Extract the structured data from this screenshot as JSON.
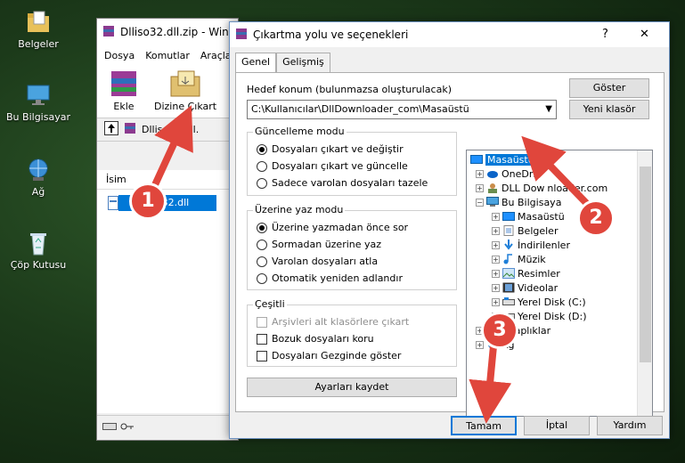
{
  "desktop": {
    "icons": [
      {
        "label": "Belgeler"
      },
      {
        "label": "Bu Bilgisayar"
      },
      {
        "label": "Ağ"
      },
      {
        "label": "Çöp Kutusu"
      }
    ]
  },
  "winrar": {
    "title": "Dlliso32.dll.zip - Win",
    "menu": [
      "Dosya",
      "Komutlar",
      "Araçla"
    ],
    "tools": {
      "add": "Ekle",
      "extract": "Dizine Çıkart"
    },
    "address": "Dlliso32.dll.",
    "column": "İsim",
    "file": "dlliso32.dll"
  },
  "dialog": {
    "title": "Çıkartma yolu ve seçenekleri",
    "help_btn": "?",
    "close_btn": "✕",
    "tabs": [
      "Genel",
      "Gelişmiş"
    ],
    "dest_label": "Hedef konum (bulunmazsa oluşturulacak)",
    "dest_value": "C:\\Kullanıcılar\\DllDownloader_com\\Masaüstü",
    "show_btn": "Göster",
    "new_folder_btn": "Yeni klasör",
    "update_group": {
      "title": "Güncelleme modu",
      "options": [
        "Dosyaları çıkart ve değiştir",
        "Dosyaları çıkart ve güncelle",
        "Sadece varolan dosyaları tazele"
      ]
    },
    "overwrite_group": {
      "title": "Üzerine yaz modu",
      "options": [
        "Üzerine yazmadan önce sor",
        "Sormadan üzerine yaz",
        "Varolan dosyaları atla",
        "Otomatik yeniden adlandır"
      ]
    },
    "misc_group": {
      "title": "Çeşitli",
      "options": [
        "Arşivleri alt klasörlere çıkart",
        "Bozuk dosyaları koru",
        "Dosyaları Gezginde göster"
      ]
    },
    "save_btn": "Ayarları kaydet",
    "tree": {
      "root": "Masaüstü",
      "items": [
        "OneDri",
        "DLL Dow",
        "Bu Bilgisaya",
        "Masaüstü",
        "Belgeler",
        "İndirilenler",
        "Müzik",
        "Resimler",
        "Videolar",
        "Yerel Disk (C:)",
        "Yerel Disk (D:)",
        "Kitaplıklar",
        "Ağ"
      ],
      "overlay_text": "nloader.com"
    },
    "ok_btn": "Tamam",
    "cancel_btn": "İptal",
    "help_footer_btn": "Yardım"
  },
  "annotations": {
    "b1": "1",
    "b2": "2",
    "b3": "3"
  },
  "colors": {
    "selection": "#0078d7",
    "badge": "#e0463c",
    "arrow": "#e0463c"
  }
}
